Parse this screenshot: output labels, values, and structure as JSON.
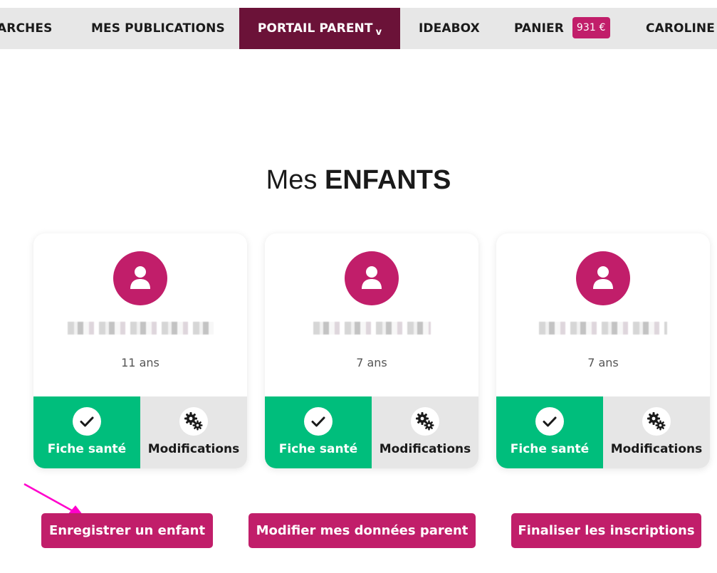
{
  "nav": {
    "items": [
      {
        "label": "ARCHES"
      },
      {
        "label": "MES PUBLICATIONS"
      },
      {
        "label": "PORTAIL PARENT",
        "caret": "v"
      },
      {
        "label": "IDEABOX"
      },
      {
        "label": "PANIER",
        "badge": "931 €"
      },
      {
        "label": "CAROLINE"
      }
    ]
  },
  "page": {
    "title_prefix": "Mes",
    "title_strong": "ENFANTS"
  },
  "children": [
    {
      "age": "11 ans",
      "health_label": "Fiche santé",
      "mod_label": "Modifications"
    },
    {
      "age": "7 ans",
      "health_label": "Fiche santé",
      "mod_label": "Modifications"
    },
    {
      "age": "7 ans",
      "health_label": "Fiche santé",
      "mod_label": "Modifications"
    }
  ],
  "actions": {
    "register": "Enregistrer un enfant",
    "edit_parent": "Modifier mes données parent",
    "finalize": "Finaliser les inscriptions"
  },
  "colors": {
    "brand": "#c11e6a",
    "nav_active": "#6b1238",
    "health_green": "#00be7c",
    "arrow": "#ff00cc"
  }
}
